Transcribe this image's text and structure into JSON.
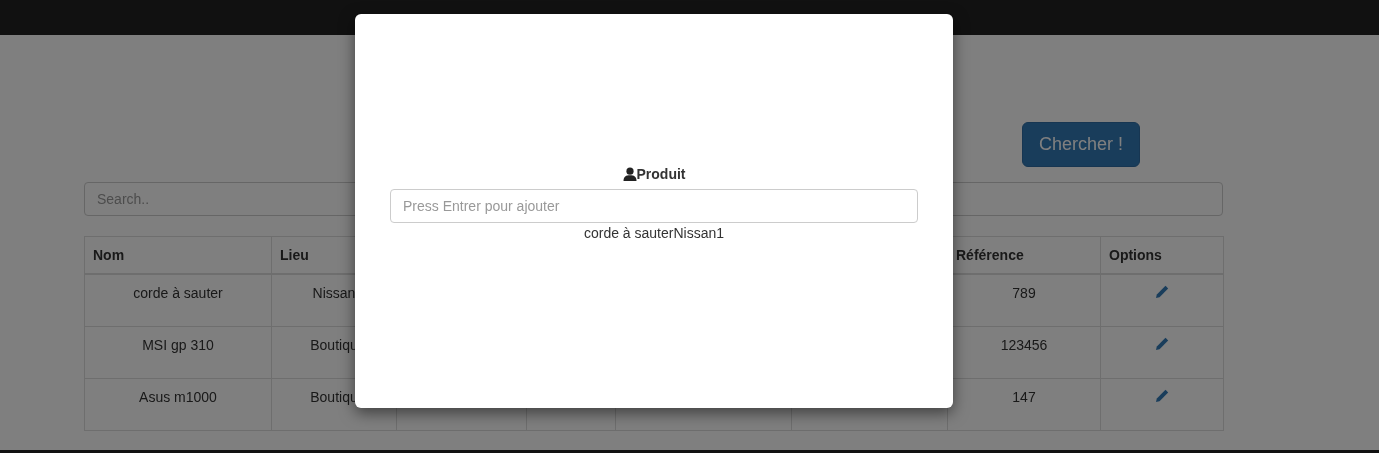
{
  "search_button": "Chercher !",
  "search": {
    "placeholder": "Search.."
  },
  "table": {
    "columns": [
      "Nom",
      "Lieu",
      "Référence",
      "Options"
    ],
    "rows": [
      {
        "nom": "corde à sauter",
        "lieu": "Nissan",
        "reference": "789"
      },
      {
        "nom": "MSI gp 310",
        "lieu": "Boutiqu",
        "reference": "123456"
      },
      {
        "nom": "Asus m1000",
        "lieu": "Boutiqu",
        "reference": "147"
      }
    ]
  },
  "modal": {
    "label": "Produit",
    "input": {
      "placeholder": "Press Entrer pour ajouter"
    },
    "items": [
      "corde à sauterNissan1"
    ]
  }
}
